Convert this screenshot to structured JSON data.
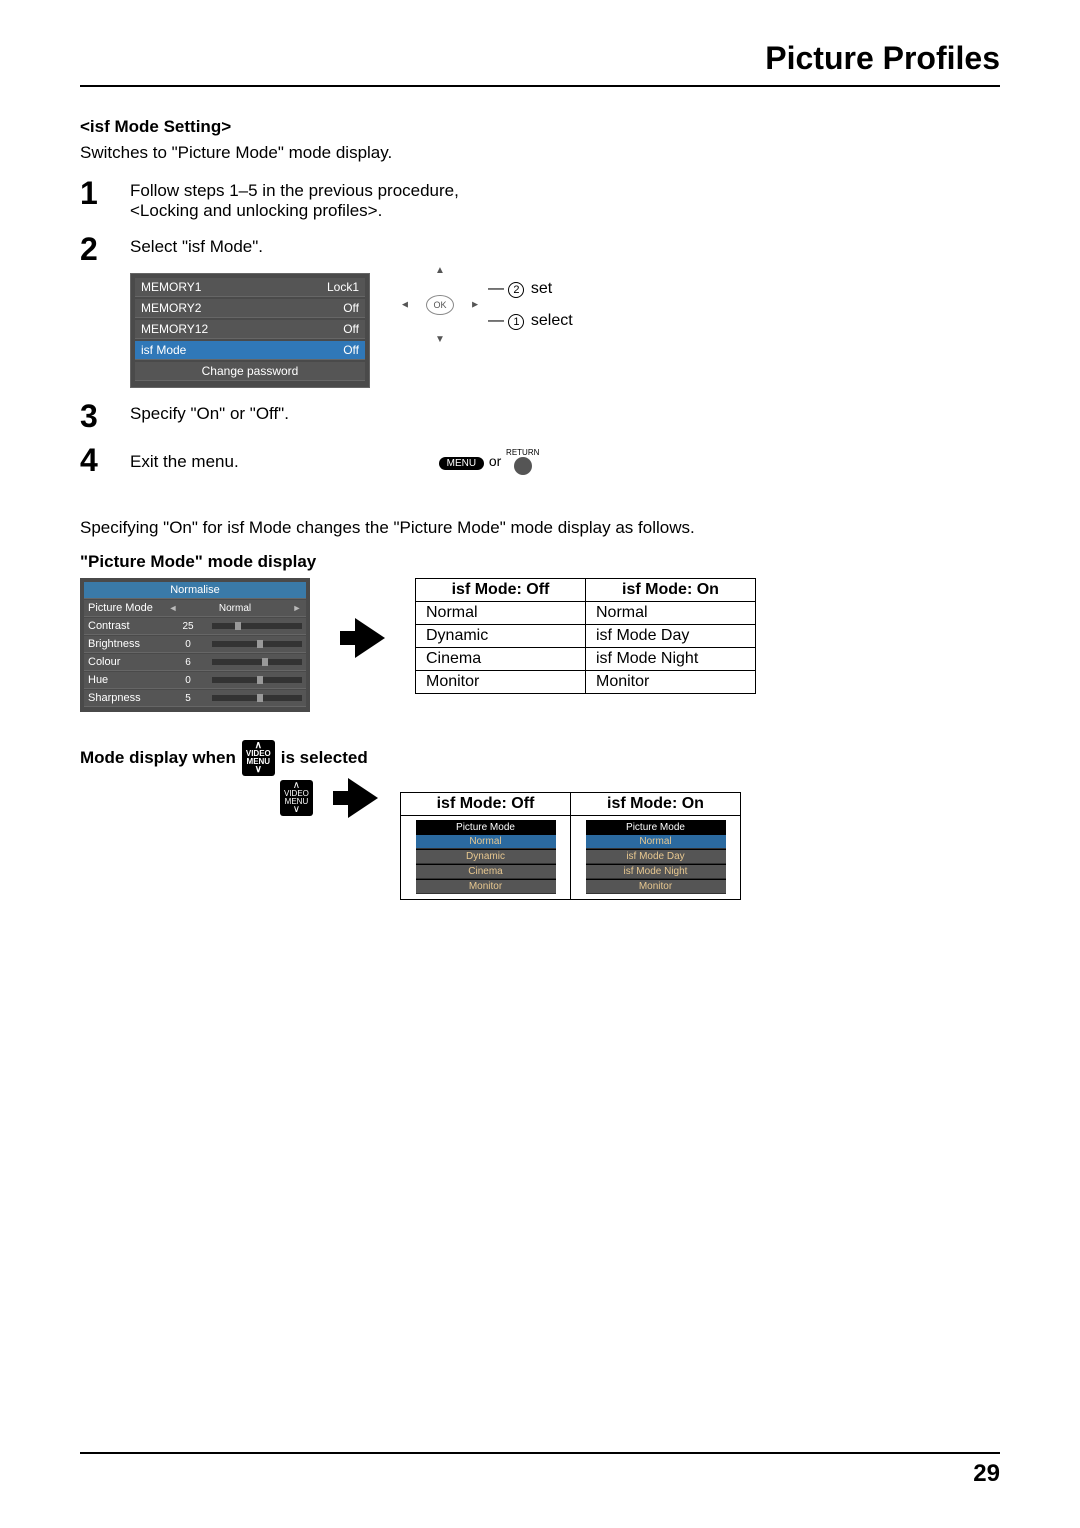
{
  "page_title": "Picture Profiles",
  "section_heading": "<isf Mode Setting>",
  "intro": "Switches to \"Picture Mode\" mode display.",
  "steps": {
    "s1": {
      "num": "1",
      "text_a": "Follow steps 1–5 in the previous procedure,",
      "text_b": "<Locking and unlocking profiles>."
    },
    "s2": {
      "num": "2",
      "text": "Select \"isf Mode\"."
    },
    "s3": {
      "num": "3",
      "text": "Specify \"On\" or \"Off\"."
    },
    "s4": {
      "num": "4",
      "text": "Exit the menu."
    }
  },
  "mem_menu": {
    "r0": {
      "label": "MEMORY1",
      "val": "Lock1"
    },
    "r1": {
      "label": "MEMORY2",
      "val": "Off"
    },
    "r2": {
      "label": "MEMORY12",
      "val": "Off"
    },
    "r3": {
      "label": "isf Mode",
      "val": "Off"
    },
    "r4": {
      "label": "Change password"
    }
  },
  "dpad": {
    "ok": "OK",
    "set": "set",
    "select": "select",
    "n2": "2",
    "n1": "1"
  },
  "exit": {
    "menu": "MENU",
    "or": "or",
    "return": "RETURN"
  },
  "mid_text": "Specifying \"On\" for isf Mode changes the \"Picture Mode\" mode display as follows.",
  "pm_heading": "\"Picture Mode\" mode display",
  "pm_menu": {
    "normalise": "Normalise",
    "r0": {
      "label": "Picture Mode",
      "val": "Normal"
    },
    "r1": {
      "label": "Contrast",
      "val": "25"
    },
    "r2": {
      "label": "Brightness",
      "val": "0"
    },
    "r3": {
      "label": "Colour",
      "val": "6"
    },
    "r4": {
      "label": "Hue",
      "val": "0"
    },
    "r5": {
      "label": "Sharpness",
      "val": "5"
    }
  },
  "cmp": {
    "h_off": "isf Mode: Off",
    "h_on": "isf Mode: On",
    "rows": {
      "r0": {
        "off": "Normal",
        "on": "Normal"
      },
      "r1": {
        "off": "Dynamic",
        "on": "isf Mode Day"
      },
      "r2": {
        "off": "Cinema",
        "on": "isf Mode Night"
      },
      "r3": {
        "off": "Monitor",
        "on": "Monitor"
      }
    }
  },
  "vm_heading_a": "Mode display when",
  "vm_heading_b": "is selected",
  "vm_chip": {
    "line1": "VIDEO",
    "line2": "MENU"
  },
  "osd": {
    "title": "Picture Mode",
    "off": {
      "i0": "Normal",
      "i1": "Dynamic",
      "i2": "Cinema",
      "i3": "Monitor"
    },
    "on": {
      "i0": "Normal",
      "i1": "isf Mode Day",
      "i2": "isf Mode Night",
      "i3": "Monitor"
    }
  },
  "page_num": "29"
}
